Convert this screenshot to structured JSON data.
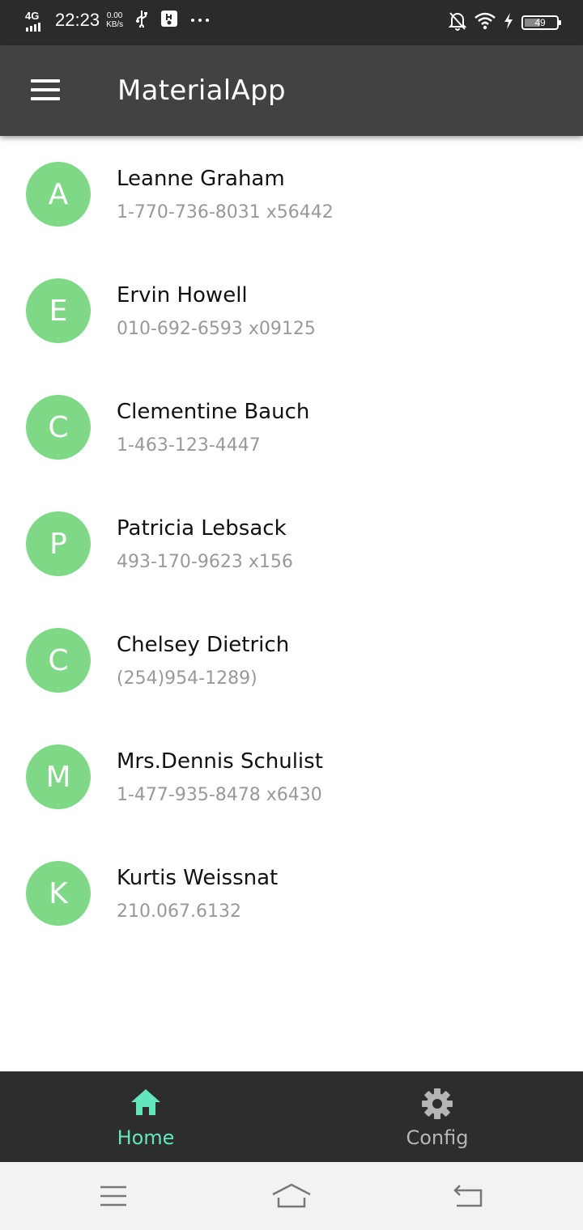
{
  "status_bar": {
    "network": "4G",
    "time": "22:23",
    "speed_value": "0.00",
    "speed_unit": "KB/s",
    "battery_level": "49",
    "battery_fill": 0.49
  },
  "app_bar": {
    "title": "MaterialApp",
    "menu_icon": "hamburger-menu-icon"
  },
  "contacts": [
    {
      "initial": "A",
      "name": "Leanne Graham",
      "phone": "1-770-736-8031 x56442"
    },
    {
      "initial": "E",
      "name": "Ervin Howell",
      "phone": "010-692-6593 x09125"
    },
    {
      "initial": "C",
      "name": "Clementine Bauch",
      "phone": "1-463-123-4447"
    },
    {
      "initial": "P",
      "name": "Patricia Lebsack",
      "phone": "493-170-9623 x156"
    },
    {
      "initial": "C",
      "name": "Chelsey Dietrich",
      "phone": "(254)954-1289)"
    },
    {
      "initial": "M",
      "name": "Mrs.Dennis Schulist",
      "phone": "1-477-935-8478 x6430"
    },
    {
      "initial": "K",
      "name": "Kurtis Weissnat",
      "phone": "210.067.6132"
    }
  ],
  "bottom_nav": {
    "home_label": "Home",
    "config_label": "Config",
    "active_color": "#63e6be",
    "inactive_color": "#b5b5b5"
  },
  "colors": {
    "status_bar": "#2b2b2b",
    "app_bar": "#424242",
    "avatar": "#7ed886",
    "bottom_nav": "#2d2d2d"
  }
}
